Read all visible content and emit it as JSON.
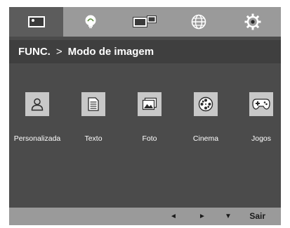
{
  "tabs": [
    {
      "name": "picture-icon",
      "active": true
    },
    {
      "name": "eco-bulb-icon",
      "active": false
    },
    {
      "name": "pip-screens-icon",
      "active": false
    },
    {
      "name": "globe-icon",
      "active": false
    },
    {
      "name": "gear-icon",
      "active": false
    }
  ],
  "breadcrumb": {
    "section": "FUNC.",
    "separator": ">",
    "current": "Modo de imagem"
  },
  "modes": [
    {
      "label": "Personalizada",
      "icon": "person-icon"
    },
    {
      "label": "Texto",
      "icon": "document-icon"
    },
    {
      "label": "Foto",
      "icon": "photo-icon"
    },
    {
      "label": "Cinema",
      "icon": "film-reel-icon"
    },
    {
      "label": "Jogos",
      "icon": "gamepad-icon"
    }
  ],
  "footer": {
    "left": "◄",
    "right": "►",
    "down": "▼",
    "exit": "Sair"
  },
  "colors": {
    "panel": "#4b4b4b",
    "bars": "#9a9a9a",
    "active_tab": "#5c5c5c",
    "icon_box": "#c8c8c8"
  }
}
